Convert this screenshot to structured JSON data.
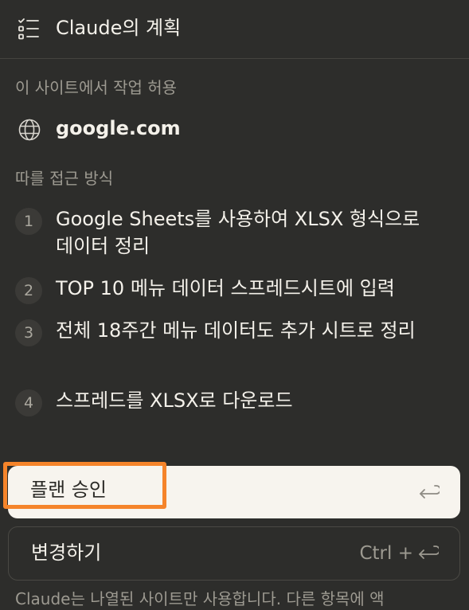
{
  "header": {
    "title": "Claude의 계획",
    "icon": "checklist-icon"
  },
  "permission": {
    "label": "이 사이트에서 작업 허용",
    "domain": "google.com",
    "icon": "globe-icon"
  },
  "approach": {
    "label": "따를 접근 방식",
    "steps": [
      {
        "number": "1",
        "text": "Google Sheets를 사용하여 XLSX 형식으로 데이터 정리"
      },
      {
        "number": "2",
        "text": "TOP 10 메뉴 데이터 스프레드시트에 입력"
      },
      {
        "number": "3",
        "text": "전체 18주간 메뉴 데이터도 추가 시트로 정리"
      },
      {
        "number": "4",
        "text": "스프레드를 XLSX로 다운로드"
      }
    ]
  },
  "actions": {
    "approve_label": "플랜 승인",
    "approve_icon": "enter-icon",
    "change_label": "변경하기",
    "change_shortcut": "Ctrl +",
    "change_icon": "enter-icon"
  },
  "footer": {
    "note": "Claude는 나열된 사이트만 사용합니다. 다른 항목에 액"
  },
  "colors": {
    "background": "#2d2d2b",
    "approve_bg": "#f7f4ee",
    "highlight": "#f5842a",
    "muted_text": "#9d9a91"
  }
}
